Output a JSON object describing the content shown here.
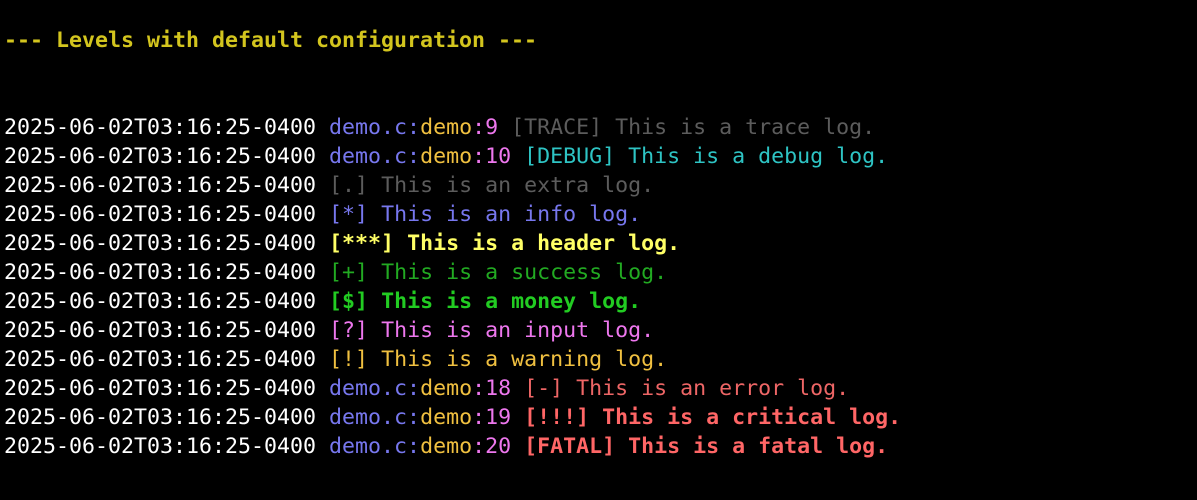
{
  "heading": "--- Levels with default configuration ---",
  "colors": {
    "background": "#000000",
    "timestamp": "#ffffff",
    "file": "#7777ee",
    "colon": "#7777ee",
    "func": "#f0c040",
    "line_number": "#ee77ee",
    "heading": "#d3c51e",
    "trace": "#5c5c5c",
    "debug": "#2ec4c4",
    "extra": "#5c5c5c",
    "info": "#7777ee",
    "header": "#ffff66",
    "success": "#22aa22",
    "money": "#22cc22",
    "input": "#ee77ee",
    "warning": "#f0c040",
    "error": "#ee6666",
    "critical": "#ff6666",
    "fatal": "#ff6666"
  },
  "logs": [
    {
      "timestamp": "2025-06-02T03:16:25-0400",
      "file": "demo.c",
      "func": "demo",
      "line": "9",
      "tag": "[TRACE]",
      "message": "This is a trace log."
    },
    {
      "timestamp": "2025-06-02T03:16:25-0400",
      "file": "demo.c",
      "func": "demo",
      "line": "10",
      "tag": "[DEBUG]",
      "message": "This is a debug log."
    },
    {
      "timestamp": "2025-06-02T03:16:25-0400",
      "tag": "[.]",
      "message": "This is an extra log."
    },
    {
      "timestamp": "2025-06-02T03:16:25-0400",
      "tag": "[*]",
      "message": "This is an info log."
    },
    {
      "timestamp": "2025-06-02T03:16:25-0400",
      "tag": "[***]",
      "message": "This is a header log."
    },
    {
      "timestamp": "2025-06-02T03:16:25-0400",
      "tag": "[+]",
      "message": "This is a success log."
    },
    {
      "timestamp": "2025-06-02T03:16:25-0400",
      "tag": "[$]",
      "message": "This is a money log."
    },
    {
      "timestamp": "2025-06-02T03:16:25-0400",
      "tag": "[?]",
      "message": "This is an input log."
    },
    {
      "timestamp": "2025-06-02T03:16:25-0400",
      "tag": "[!]",
      "message": "This is a warning log."
    },
    {
      "timestamp": "2025-06-02T03:16:25-0400",
      "file": "demo.c",
      "func": "demo",
      "line": "18",
      "tag": "[-]",
      "message": "This is an error log."
    },
    {
      "timestamp": "2025-06-02T03:16:25-0400",
      "file": "demo.c",
      "func": "demo",
      "line": "19",
      "tag": "[!!!]",
      "message": "This is a critical log."
    },
    {
      "timestamp": "2025-06-02T03:16:25-0400",
      "file": "demo.c",
      "func": "demo",
      "line": "20",
      "tag": "[FATAL]",
      "message": "This is a fatal log."
    }
  ]
}
